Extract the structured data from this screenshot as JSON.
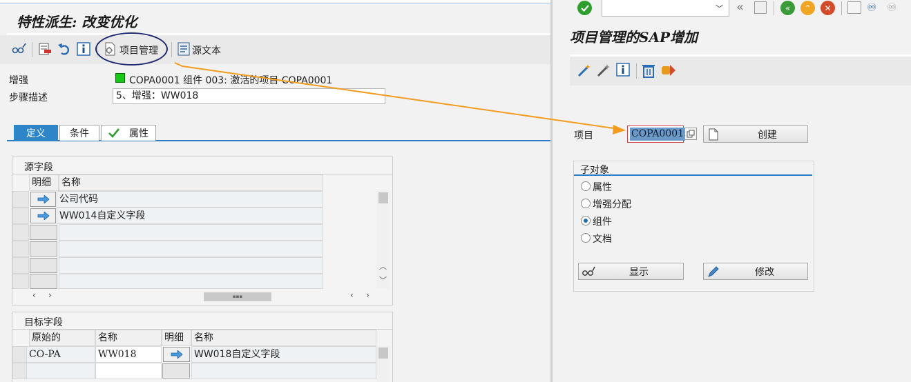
{
  "left_window": {
    "title": "特性派生: 改变优化",
    "toolbar": {
      "project_mgmt_label": "项目管理",
      "source_text_label": "源文本"
    },
    "fields": {
      "enhancement_label": "增强",
      "enhancement_value": "COPA0001 组件 003: 激活的项目 COPA0001",
      "step_desc_label": "步骤描述",
      "step_desc_value": "5、增强：WW018"
    },
    "tabs": [
      {
        "label": "定义",
        "active": true
      },
      {
        "label": "条件",
        "active": false
      },
      {
        "label": "属性",
        "active": false
      }
    ],
    "source_fields": {
      "title": "源字段",
      "col_detail": "明细",
      "col_name": "名称",
      "rows": [
        {
          "name": "公司代码"
        },
        {
          "name": "WW014自定义字段"
        }
      ],
      "scroll_thumb": "▪▪▪"
    },
    "target_fields": {
      "title": "目标字段",
      "col_original": "原始的",
      "col_name": "名称",
      "col_detail": "明细",
      "col_name2": "名称",
      "rows": [
        {
          "original": "CO-PA",
          "name": "WW018",
          "name2": "WW018自定义字段"
        }
      ]
    }
  },
  "right_window": {
    "command_field": "",
    "title": "项目管理的SAP增加",
    "project_label": "项目",
    "project_value": "COPA0001",
    "create_button": "创建",
    "sub_objects": {
      "title": "子对象",
      "options": [
        {
          "label": "属性",
          "selected": false
        },
        {
          "label": "增强分配",
          "selected": false
        },
        {
          "label": "组件",
          "selected": true
        },
        {
          "label": "文档",
          "selected": false
        }
      ]
    },
    "display_button": "显示",
    "change_button": "修改"
  },
  "colors": {
    "accent_blue": "#2e86c8",
    "annotation_orange": "#f39c1f",
    "circle_navy": "#1f2a70",
    "status_green": "#19c819"
  }
}
